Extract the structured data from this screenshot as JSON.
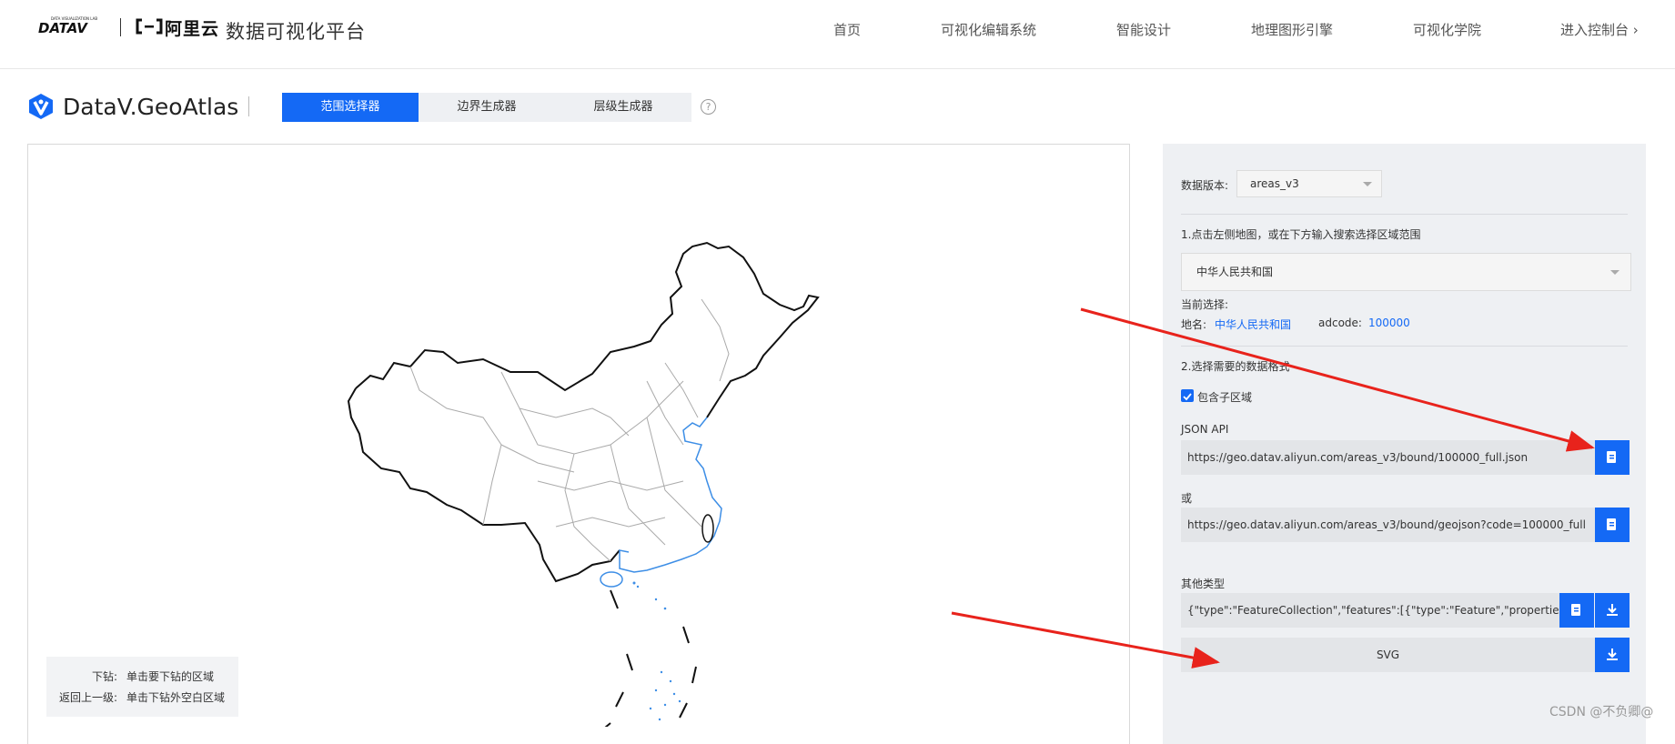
{
  "brand": {
    "datav_logo": "DATAV",
    "datav_tagline": "DATA VISUALIZATION LAB",
    "aliyun_logo": "阿里云",
    "platform_title": "数据可视化平台"
  },
  "nav": [
    "首页",
    "可视化编辑系统",
    "智能设计",
    "地理图形引擎",
    "可视化学院",
    "进入控制台 ›"
  ],
  "geo": {
    "title": "DataV.GeoAtlas",
    "tabs": [
      "范围选择器",
      "边界生成器",
      "层级生成器"
    ],
    "active_tab": 0,
    "help_icon": "?"
  },
  "map": {
    "legend": [
      {
        "key": "下钻:",
        "value": "单击要下钻的区域"
      },
      {
        "key": "返回上一级:",
        "value": "单击下钻外空白区域"
      }
    ]
  },
  "panel": {
    "version_label": "数据版本:",
    "version_value": "areas_v3",
    "step1": "1.点击左侧地图，或在下方输入搜索选择区域范围",
    "region_value": "中华人民共和国",
    "current_label": "当前选择:",
    "name_label": "地名:",
    "name_value": "中华人民共和国",
    "adcode_label": "adcode:",
    "adcode_value": "100000",
    "step2": "2.选择需要的数据格式",
    "include_children": "包含子区域",
    "json_api_label": "JSON API",
    "json_api_url": "https://geo.datav.aliyun.com/areas_v3/bound/100000_full.json",
    "or_label": "或",
    "geojson_url": "https://geo.datav.aliyun.com/areas_v3/bound/geojson?code=100000_full",
    "other_label": "其他类型",
    "other_value": "{\"type\":\"FeatureCollection\",\"features\":[{\"type\":\"Feature\",\"properties\":{\"adcode\"",
    "svg_label": "SVG"
  },
  "icons": [
    "copy-icon",
    "download-icon",
    "check-icon",
    "caret-down-icon",
    "help-icon"
  ],
  "colors": {
    "accent": "#1469f5",
    "annotation_arrow": "#e8231c",
    "coastline": "#3d8ee6"
  },
  "watermark": "CSDN @不负卿@"
}
